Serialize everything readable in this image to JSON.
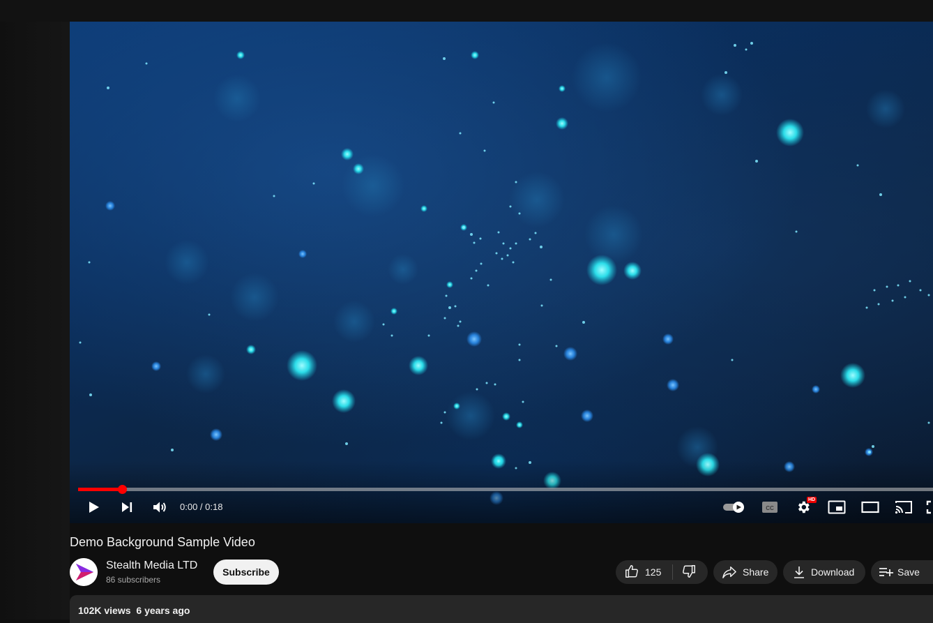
{
  "player": {
    "time_display": "0:00 / 0:18",
    "progress_fraction": 0.051,
    "hd_badge": "HD",
    "progress_color": "#ff0000"
  },
  "video": {
    "title": "Demo Background Sample Video"
  },
  "channel": {
    "name": "Stealth Media LTD",
    "subscribers": "86 subscribers",
    "subscribe_label": "Subscribe"
  },
  "actions": {
    "likes": "125",
    "share_label": "Share",
    "download_label": "Download",
    "save_label": "Save"
  },
  "description": {
    "views": "102K views",
    "age": "6 years ago"
  },
  "icons": {
    "play": "play-icon",
    "next": "next-icon",
    "volume": "volume-icon",
    "autoplay": "autoplay-toggle-icon",
    "captions": "captions-icon",
    "settings": "gear-icon",
    "miniplayer": "miniplayer-icon",
    "theater": "theater-mode-icon",
    "cast": "cast-icon",
    "fullscreen": "fullscreen-icon",
    "like": "thumbs-up-icon",
    "dislike": "thumbs-down-icon",
    "share": "share-icon",
    "download": "download-icon",
    "save": "playlist-add-icon"
  }
}
